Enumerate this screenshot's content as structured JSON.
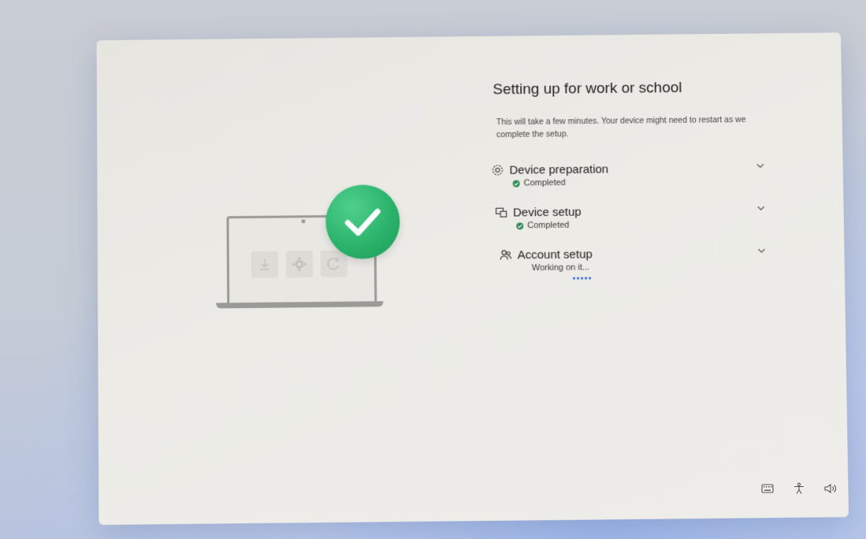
{
  "page": {
    "title": "Setting up for work or school",
    "description": "This will take a few minutes. Your device might need to restart as we complete the setup."
  },
  "steps": [
    {
      "title": "Device preparation",
      "status": "Completed",
      "state": "completed",
      "icon": "gear-icon"
    },
    {
      "title": "Device setup",
      "status": "Completed",
      "state": "completed",
      "icon": "devices-icon"
    },
    {
      "title": "Account setup",
      "status": "Working on it...",
      "state": "in-progress",
      "icon": "people-icon"
    }
  ],
  "tray": {
    "icons": [
      "keyboard-icon",
      "accessibility-icon",
      "volume-icon"
    ]
  },
  "colors": {
    "success": "#2e8b57",
    "check_badge": "#2bb36b",
    "progress": "#2a5bd7"
  }
}
